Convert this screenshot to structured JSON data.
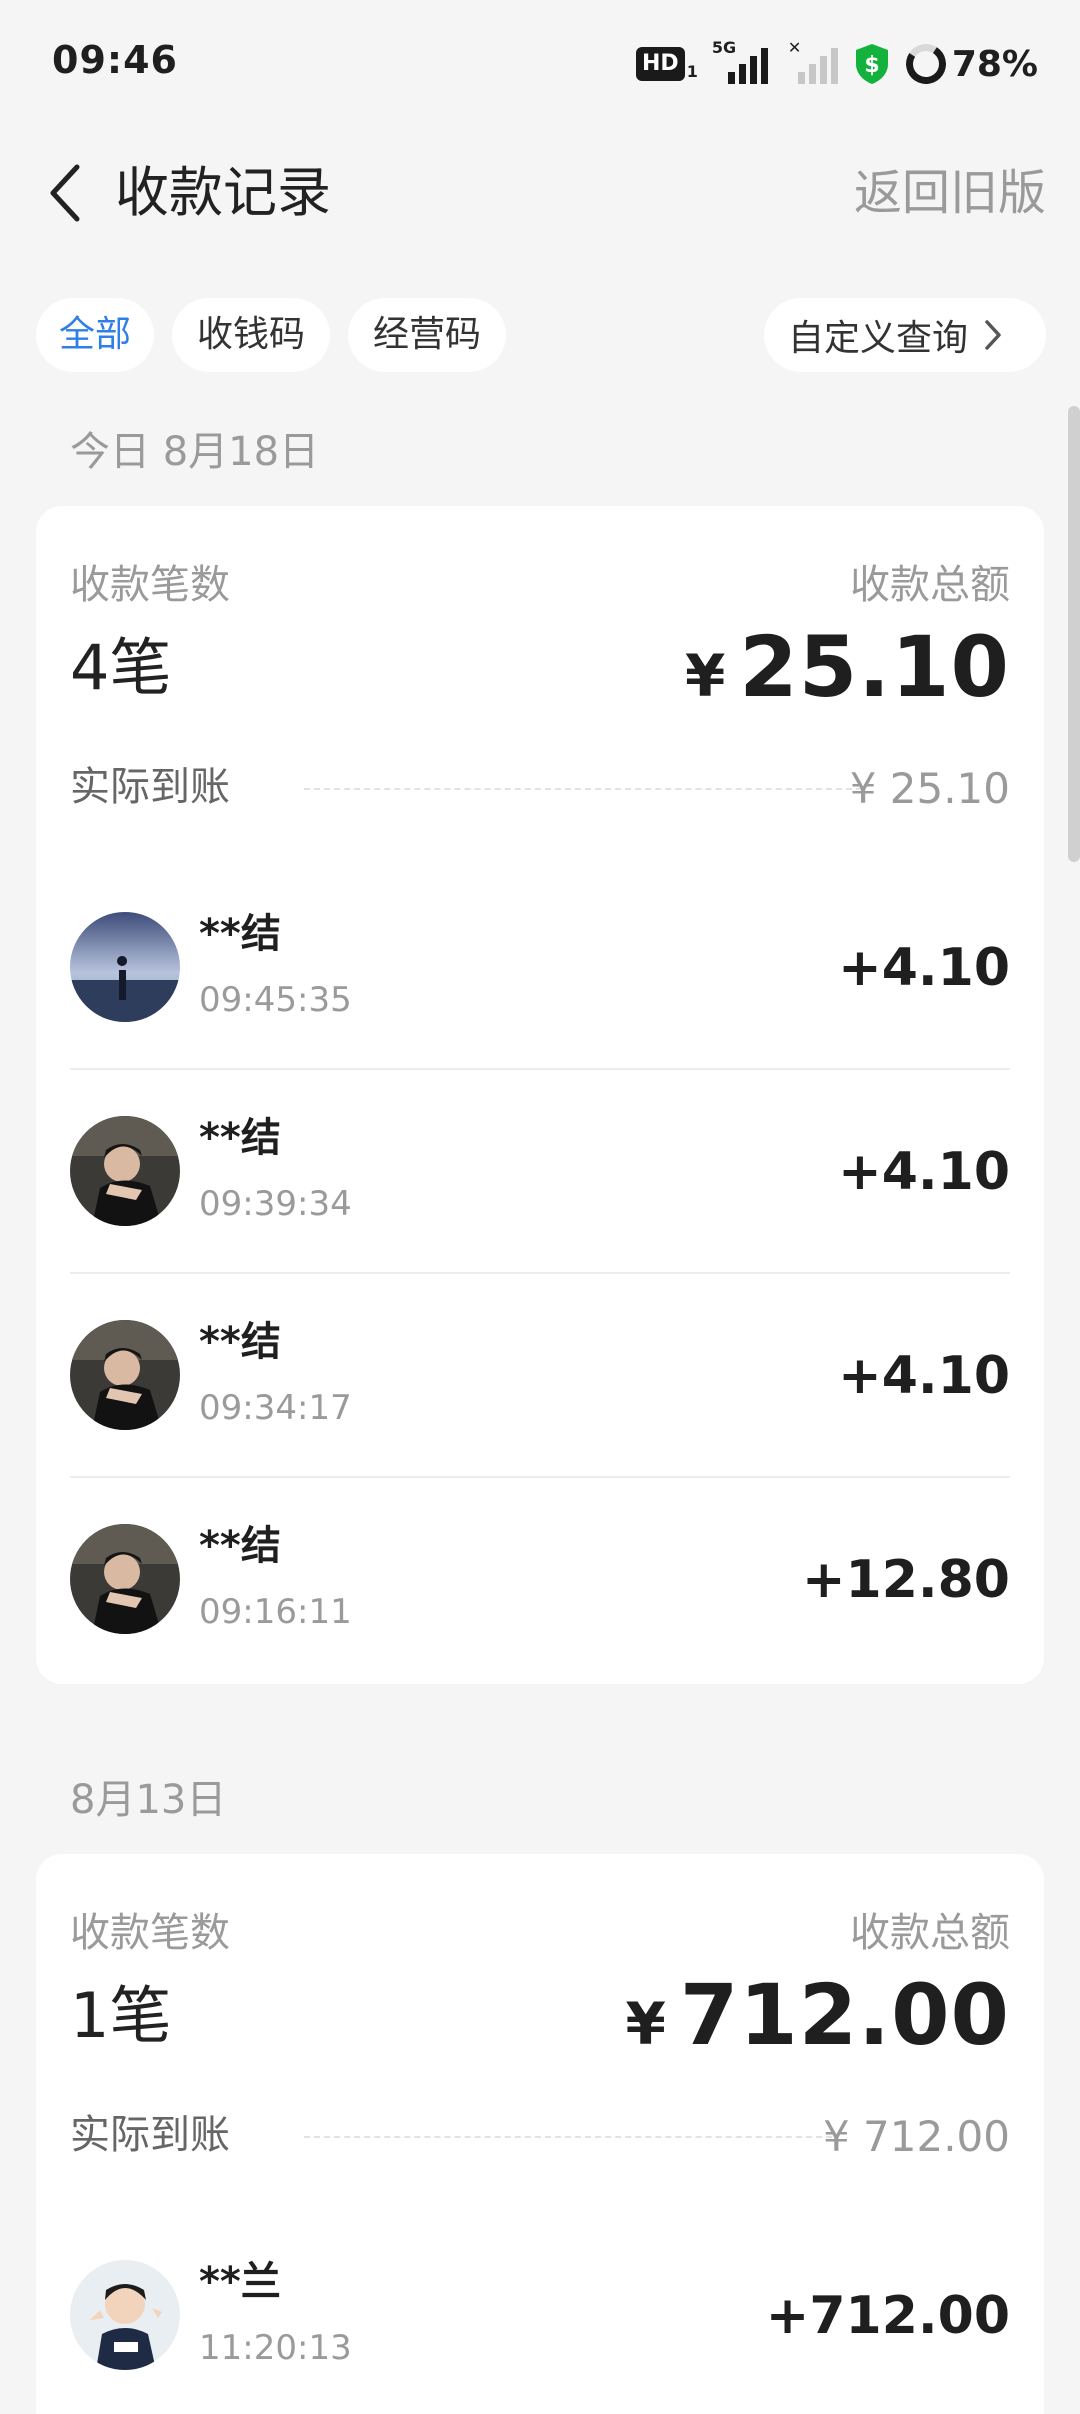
{
  "status_bar": {
    "time": "09:46",
    "hd_label": "HD",
    "hd_sub": "1",
    "network_label": "5G",
    "battery": "78%"
  },
  "header": {
    "title": "收款记录",
    "old_version": "返回旧版"
  },
  "filters": {
    "tabs": [
      {
        "label": "全部",
        "active": true
      },
      {
        "label": "收钱码",
        "active": false
      },
      {
        "label": "经营码",
        "active": false
      }
    ],
    "custom_query": "自定义查询"
  },
  "groups": [
    {
      "date": "今日 8月18日",
      "count_label": "收款笔数",
      "count": "4笔",
      "total_label": "收款总额",
      "currency": "¥",
      "total": "25.10",
      "arrive_label": "实际到账",
      "arrive_value": "¥ 25.10",
      "transactions": [
        {
          "name": "**结",
          "time": "09:45:35",
          "amount": "+4.10"
        },
        {
          "name": "**结",
          "time": "09:39:34",
          "amount": "+4.10"
        },
        {
          "name": "**结",
          "time": "09:34:17",
          "amount": "+4.10"
        },
        {
          "name": "**结",
          "time": "09:16:11",
          "amount": "+12.80"
        }
      ]
    },
    {
      "date": "8月13日",
      "count_label": "收款笔数",
      "count": "1笔",
      "total_label": "收款总额",
      "currency": "¥",
      "total": "712.00",
      "arrive_label": "实际到账",
      "arrive_value": "¥ 712.00",
      "transactions": [
        {
          "name": "**兰",
          "time": "11:20:13",
          "amount": "+712.00"
        }
      ]
    }
  ],
  "colors": {
    "accent": "#2f7fe6",
    "background": "#f5f5f5",
    "muted_text": "#9a9a9a",
    "shield_green": "#12b23c"
  }
}
